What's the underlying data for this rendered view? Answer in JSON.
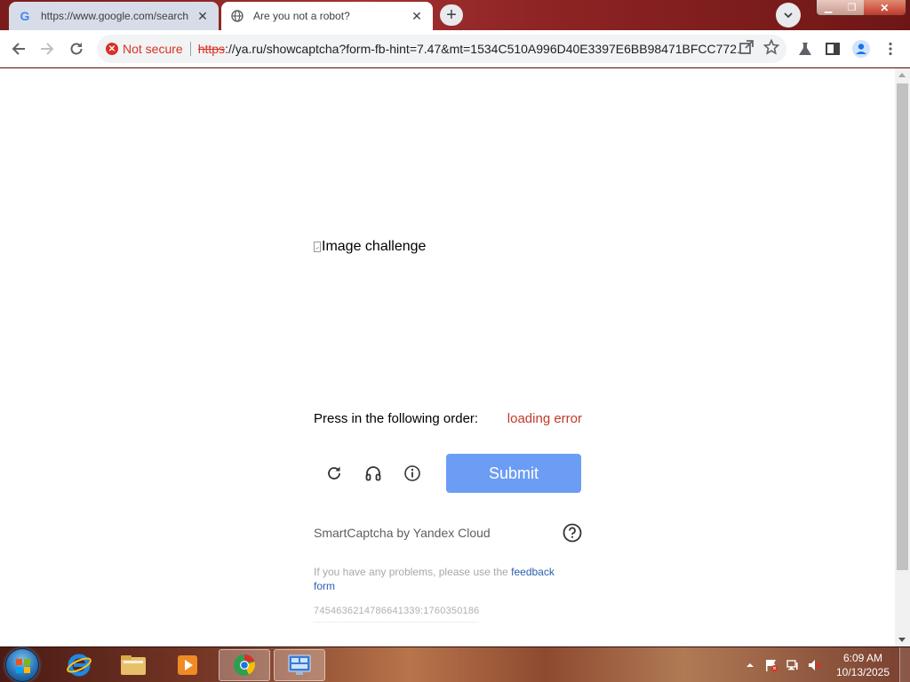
{
  "browser": {
    "tabs": [
      {
        "title": "https://www.google.com/search",
        "icon": "google-icon",
        "active": false
      },
      {
        "title": "Are you not a robot?",
        "icon": "globe-icon",
        "active": true
      }
    ],
    "omnibox": {
      "security_label": "Not secure",
      "url_scheme": "https",
      "url_rest": "://ya.ru/showcaptcha?form-fb-hint=7.47&mt=1534C510A996D40E3397E6BB98471BFCC772..."
    }
  },
  "captcha": {
    "image_alt": "Image challenge",
    "order_label": "Press in the following order:",
    "order_status": "loading error",
    "submit_label": "Submit",
    "brand": "SmartCaptcha by Yandex Cloud",
    "problem_text": "If you have any problems, please use the ",
    "feedback_link": "feedback form",
    "request_id": "7454636214786641339:1760350186"
  },
  "taskbar": {
    "time": "6:09 AM",
    "date": "10/13/2025"
  },
  "colors": {
    "accent_submit": "#6b9df5",
    "error_red": "#c0392b",
    "link_blue": "#2a5db0",
    "insecure_red": "#d93025"
  }
}
